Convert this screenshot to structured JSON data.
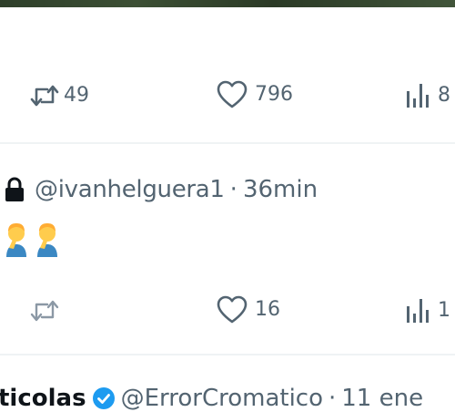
{
  "tweet1": {
    "retweets": "49",
    "likes": "796",
    "views": "8"
  },
  "tweet2": {
    "handle": "@ivanhelguera1",
    "separator": "·",
    "time": "36min",
    "text_emoji": "🤦‍♂️🤦‍♂️",
    "likes": "16",
    "views": "1"
  },
  "tweet3": {
    "author": "ticolas",
    "handle": "@ErrorCromatico",
    "separator": "·",
    "time": "11 ene"
  },
  "colors": {
    "secondary_text": "#536471",
    "divider": "#eff3f4",
    "verified": "#1d9bf0",
    "primary_text": "#0f1419"
  }
}
